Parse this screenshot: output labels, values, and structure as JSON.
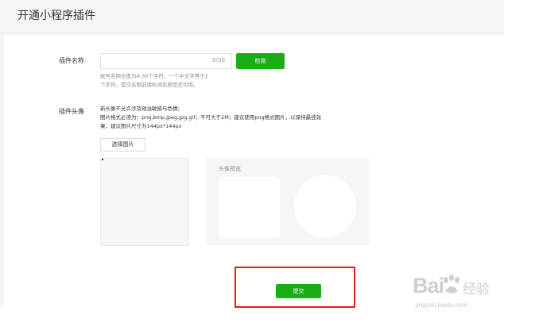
{
  "page": {
    "title": "开通小程序插件"
  },
  "form": {
    "name_label": "插件名称",
    "name_input": {
      "value": "",
      "counter": "0/30"
    },
    "check_button": "检测",
    "name_hint_line1": "帐号名称长度为4-30个字符，一个中文字等于2",
    "name_hint_line2": "个字符。提交名称前请检测名称是否可用。",
    "avatar_label": "插件头像",
    "avatar_desc_line1": "新头像不允许涉及政治敏感与色情;",
    "avatar_desc_line2": "图片格式必须为：png,bmp,jpeg,jpg,gif；不可大于2M；建议使用png格式图片，以保持最佳效",
    "avatar_desc_line3": "果；建议图片尺寸为144px*144px",
    "select_image_button": "选择图片",
    "preview_label": "头像预览",
    "submit_button": "提交"
  },
  "watermark": {
    "brand_left": "Bai",
    "brand_right": "经验",
    "url": "jingyan.baidu.com"
  },
  "colors": {
    "accent_green": "#1aad19",
    "highlight_red": "#e02020",
    "page_bg": "#f4f5f7"
  }
}
